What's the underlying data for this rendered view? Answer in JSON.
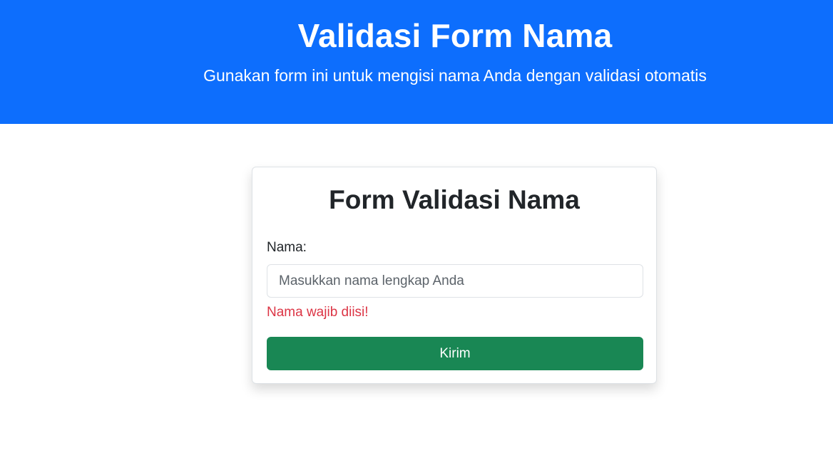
{
  "hero": {
    "title": "Validasi Form Nama",
    "subtitle": "Gunakan form ini untuk mengisi nama Anda dengan validasi otomatis"
  },
  "form": {
    "title": "Form Validasi Nama",
    "name_label": "Nama:",
    "name_value": "",
    "name_placeholder": "Masukkan nama lengkap Anda",
    "error_message": "Nama wajib diisi!",
    "submit_label": "Kirim"
  },
  "colors": {
    "hero_background": "#0d6efd",
    "error": "#dc3545",
    "submit_background": "#198754"
  }
}
